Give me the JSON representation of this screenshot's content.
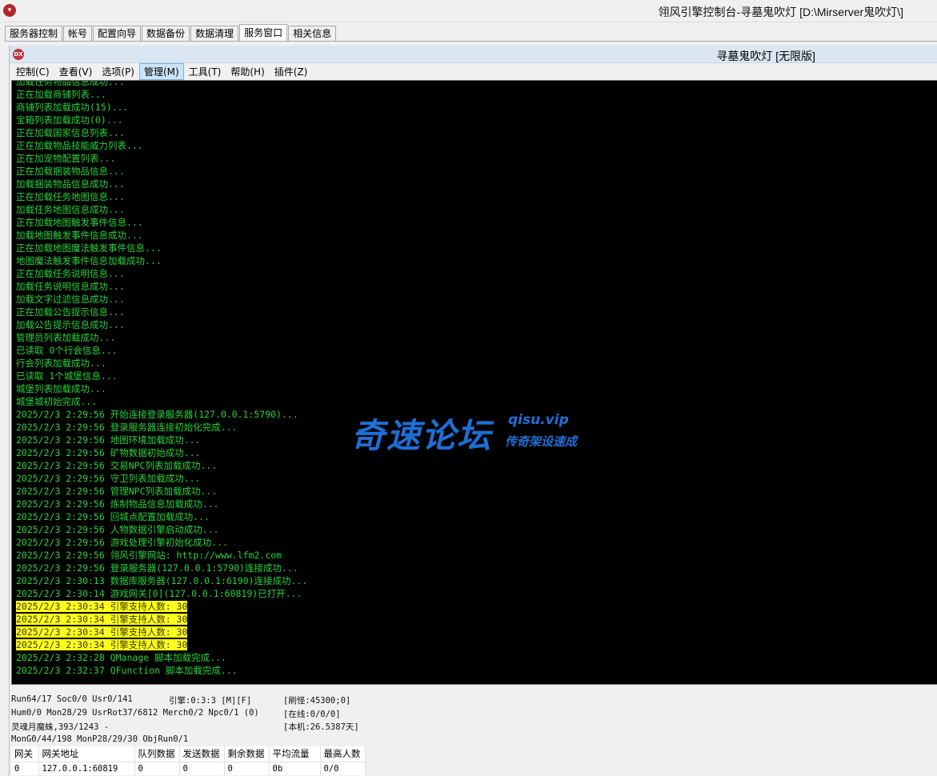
{
  "window": {
    "title": "翎风引擎控制台-寻墓鬼吹灯 [D:\\Mirserver鬼吹灯\\]",
    "logo": "app-logo"
  },
  "tabs": [
    {
      "label": "服务器控制",
      "active": false
    },
    {
      "label": "帐号",
      "active": false
    },
    {
      "label": "配置向导",
      "active": false
    },
    {
      "label": "数据备份",
      "active": false
    },
    {
      "label": "数据清理",
      "active": false
    },
    {
      "label": "服务窗口",
      "active": true
    },
    {
      "label": "相关信息",
      "active": false
    }
  ],
  "inner_window": {
    "title": "寻墓鬼吹灯 [无限版]",
    "logo_text": "DX"
  },
  "menu": [
    {
      "label": "控制(C)",
      "active": false
    },
    {
      "label": "查看(V)",
      "active": false
    },
    {
      "label": "选项(P)",
      "active": false
    },
    {
      "label": "管理(M)",
      "active": true
    },
    {
      "label": "工具(T)",
      "active": false
    },
    {
      "label": "帮助(H)",
      "active": false
    },
    {
      "label": "插件(Z)",
      "active": false
    }
  ],
  "console": {
    "text_color": "#27d43a",
    "highlight_color": "#ffff1a",
    "lines": [
      {
        "text": "加载任务物品信息成功...",
        "highlight": false
      },
      {
        "text": "正在加载商铺列表...",
        "highlight": false
      },
      {
        "text": "商铺列表加载成功(15)...",
        "highlight": false
      },
      {
        "text": "宝箱列表加载成功(0)...",
        "highlight": false
      },
      {
        "text": "正在加载国家信息列表...",
        "highlight": false
      },
      {
        "text": "正在加载物品技能威力列表...",
        "highlight": false
      },
      {
        "text": "正在加宠物配置列表...",
        "highlight": false
      },
      {
        "text": "正在加载捆装物品信息...",
        "highlight": false
      },
      {
        "text": "加载捆装物品信息成功...",
        "highlight": false
      },
      {
        "text": "正在加载任务地图信息...",
        "highlight": false
      },
      {
        "text": "加载任务地图信息成功...",
        "highlight": false
      },
      {
        "text": "正在加载地图触发事件信息...",
        "highlight": false
      },
      {
        "text": "加载地图触发事件信息成功...",
        "highlight": false
      },
      {
        "text": "正在加载地图魔法触发事件信息...",
        "highlight": false
      },
      {
        "text": "地图魔法触发事件信息加载成功...",
        "highlight": false
      },
      {
        "text": "正在加载任务说明信息...",
        "highlight": false
      },
      {
        "text": "加载任务说明信息成功...",
        "highlight": false
      },
      {
        "text": "加载文字过滤信息成功...",
        "highlight": false
      },
      {
        "text": "正在加载公告提示信息...",
        "highlight": false
      },
      {
        "text": "加载公告提示信息成功...",
        "highlight": false
      },
      {
        "text": "管理员列表加载成功...",
        "highlight": false
      },
      {
        "text": "已读取 0个行会信息...",
        "highlight": false
      },
      {
        "text": "行会列表加载成功...",
        "highlight": false
      },
      {
        "text": "已读取 1个城堡信息...",
        "highlight": false
      },
      {
        "text": "城堡列表加载成功...",
        "highlight": false
      },
      {
        "text": "城堡城初始完成...",
        "highlight": false
      },
      {
        "text": "2025/2/3 2:29:56 开始连接登录服务器(127.0.0.1:5790)...",
        "highlight": false
      },
      {
        "text": "2025/2/3 2:29:56 登录服务器连接初始化完成...",
        "highlight": false
      },
      {
        "text": "2025/2/3 2:29:56 地图环境加载成功...",
        "highlight": false
      },
      {
        "text": "2025/2/3 2:29:56 矿物数据初始成功...",
        "highlight": false
      },
      {
        "text": "2025/2/3 2:29:56 交易NPC列表加载成功...",
        "highlight": false
      },
      {
        "text": "2025/2/3 2:29:56 守卫列表加载成功...",
        "highlight": false
      },
      {
        "text": "2025/2/3 2:29:56 管理NPC列表加载成功...",
        "highlight": false
      },
      {
        "text": "2025/2/3 2:29:56 炼制物品信息加载成功...",
        "highlight": false
      },
      {
        "text": "2025/2/3 2:29:56 回城点配置加载成功...",
        "highlight": false
      },
      {
        "text": "2025/2/3 2:29:56 人物数据引擎启动成功...",
        "highlight": false
      },
      {
        "text": "2025/2/3 2:29:56 游戏处理引擎初始化成功...",
        "highlight": false
      },
      {
        "text": "2025/2/3 2:29:56 翎风引擎网站: http://www.lfm2.com",
        "highlight": false
      },
      {
        "text": "2025/2/3 2:29:56 登录服务器(127.0.0.1:5790)连接成功...",
        "highlight": false
      },
      {
        "text": "2025/2/3 2:30:13 数据库服务器(127.0.0.1:6190)连接成功...",
        "highlight": false
      },
      {
        "text": "2025/2/3 2:30:14 游戏网关[0](127.0.0.1:60819)已打开...",
        "highlight": false
      },
      {
        "text": "2025/2/3 2:30:34 引擎支持人数: 30",
        "highlight": true
      },
      {
        "text": "2025/2/3 2:30:34 引擎支持人数: 30",
        "highlight": true
      },
      {
        "text": "2025/2/3 2:30:34 引擎支持人数: 30",
        "highlight": true
      },
      {
        "text": "2025/2/3 2:30:34 引擎支持人数: 30",
        "highlight": true
      },
      {
        "text": "2025/2/3 2:32:28 QManage 脚本加载完成...",
        "highlight": false
      },
      {
        "text": "2025/2/3 2:32:37 QFunction 脚本加载完成...",
        "highlight": false
      }
    ]
  },
  "watermark": {
    "main": "奇速论坛",
    "url": "qisu.vip",
    "sub": "传奇架设速成",
    "color": "#1e6fd6"
  },
  "status": {
    "row1": {
      "a": "Run64/17 Soc0/0 Usr0/141",
      "b": "引擎:0:3:3 [M][F]",
      "c": "[刷怪:45300;0]"
    },
    "row2": {
      "a": "Hum0/0 Mon28/29 UsrRot37/6812 Merch0/2 Npc0/1 (0)",
      "c": "[在线:0/0/0]"
    },
    "row3": {
      "a": "灵魂月魔蛛,393/1243 -",
      "c": "[本机:26.5387天]"
    },
    "row4": {
      "a": "MonG0/44/198 MonP28/29/30 ObjRun0/1"
    }
  },
  "gate_table": {
    "headers": [
      "网关",
      "网关地址",
      "队列数据",
      "发送数据",
      "剩余数据",
      "平均流量",
      "最高人数"
    ],
    "rows": [
      [
        "0",
        "127.0.0.1:60819",
        "0",
        "0",
        "0",
        "0b",
        "0/0"
      ]
    ]
  }
}
